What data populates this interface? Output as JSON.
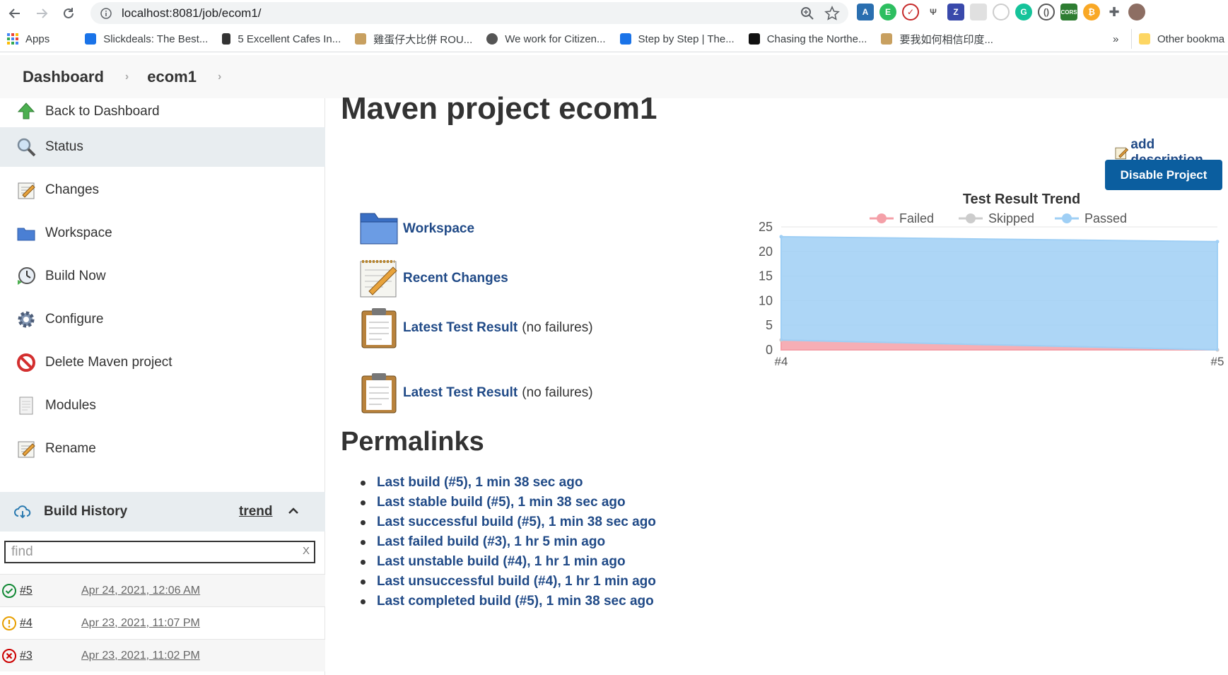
{
  "browser": {
    "url": "localhost:8081/job/ecom1/",
    "bookmarks": [
      {
        "label": "Apps",
        "color": "#4285f4"
      },
      {
        "label": "Slickdeals: The Best...",
        "color": "#1a73e8"
      },
      {
        "label": "5 Excellent Cafes In...",
        "color": "#333333"
      },
      {
        "label": "雞蛋仔大比併 ROU...",
        "color": "#c8a060"
      },
      {
        "label": "We work for Citizen...",
        "color": "#555555"
      },
      {
        "label": "Step by Step | The...",
        "color": "#1a73e8"
      },
      {
        "label": "Chasing the Northe...",
        "color": "#111111"
      },
      {
        "label": "要我如何相信印度...",
        "color": "#c8a060"
      }
    ],
    "more_bookmarks": "»",
    "other_bookmarks": "Other bookma"
  },
  "breadcrumb": {
    "items": [
      "Dashboard",
      "ecom1"
    ]
  },
  "sidebar": {
    "tasks": [
      {
        "label": "Back to Dashboard",
        "icon": "up-arrow-icon"
      },
      {
        "label": "Status",
        "icon": "magnifier-icon"
      },
      {
        "label": "Changes",
        "icon": "notepad-icon"
      },
      {
        "label": "Workspace",
        "icon": "folder-icon"
      },
      {
        "label": "Build Now",
        "icon": "clock-icon"
      },
      {
        "label": "Configure",
        "icon": "gear-icon"
      },
      {
        "label": "Delete Maven project",
        "icon": "no-entry-icon"
      },
      {
        "label": "Modules",
        "icon": "document-icon"
      },
      {
        "label": "Rename",
        "icon": "notepad-icon"
      }
    ],
    "build_history": {
      "title": "Build History",
      "trend": "trend",
      "find_placeholder": "find",
      "find_clear": "X",
      "builds": [
        {
          "number": "#5",
          "date": "Apr 24, 2021, 12:06 AM",
          "status": "success"
        },
        {
          "number": "#4",
          "date": "Apr 23, 2021, 11:07 PM",
          "status": "unstable"
        },
        {
          "number": "#3",
          "date": "Apr 23, 2021, 11:02 PM",
          "status": "failed"
        }
      ]
    }
  },
  "main": {
    "title": "Maven project ecom1",
    "add_description": "add description",
    "disable_button": "Disable Project",
    "links": [
      {
        "label": "Workspace",
        "note": "",
        "icon": "folder-icon"
      },
      {
        "label": "Recent Changes",
        "note": "",
        "icon": "notepad-icon"
      },
      {
        "label": "Latest Test Result",
        "note": "(no failures)",
        "icon": "clipboard-icon"
      },
      {
        "label": "Latest Test Result",
        "note": "(no failures)",
        "icon": "clipboard-icon"
      }
    ],
    "permalinks_heading": "Permalinks",
    "permalinks": [
      "Last build (#5), 1 min 38 sec ago",
      "Last stable build (#5), 1 min 38 sec ago",
      "Last successful build (#5), 1 min 38 sec ago",
      "Last failed build (#3), 1 hr 5 min ago",
      "Last unstable build (#4), 1 hr 1 min ago",
      "Last unsuccessful build (#4), 1 hr 1 min ago",
      "Last completed build (#5), 1 min 38 sec ago"
    ]
  },
  "colors": {
    "link": "#204a87",
    "button": "#0b5e9f",
    "failed": "#f4a0a8",
    "skipped": "#cccccc",
    "passed": "#9fcff5"
  },
  "chart_data": {
    "type": "area",
    "title": "Test Result Trend",
    "categories": [
      "#4",
      "#5"
    ],
    "series": [
      {
        "name": "Failed",
        "values": [
          2,
          0
        ],
        "color": "#f4a0a8"
      },
      {
        "name": "Skipped",
        "values": [
          0,
          0
        ],
        "color": "#cccccc"
      },
      {
        "name": "Passed",
        "values": [
          21,
          22
        ],
        "color": "#9fcff5"
      }
    ],
    "stacked": true,
    "ylim": [
      0,
      25
    ],
    "yticks": [
      0,
      5,
      10,
      15,
      20,
      25
    ],
    "legend": "top"
  }
}
